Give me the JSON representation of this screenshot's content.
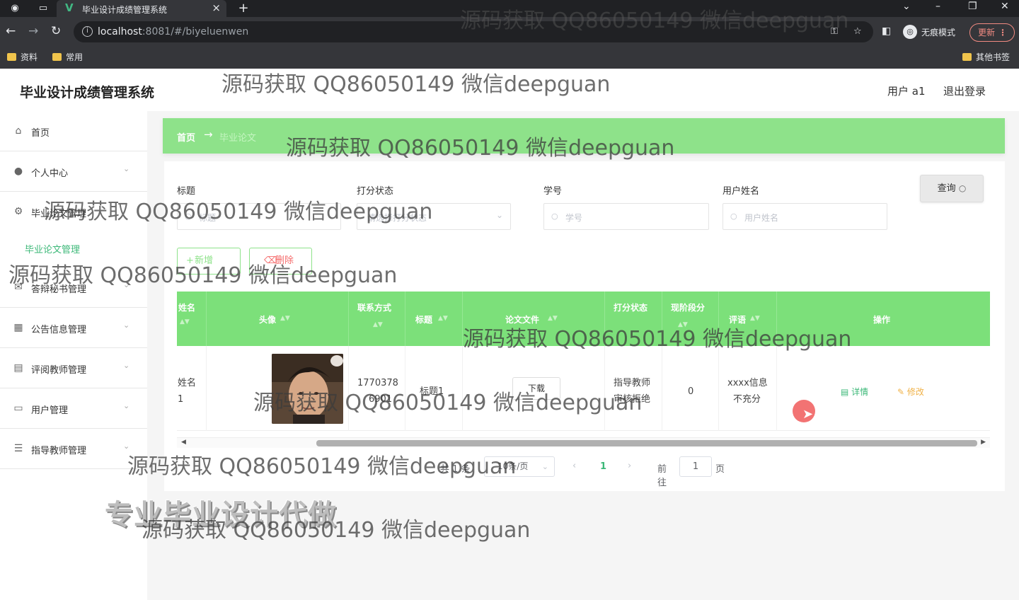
{
  "browser": {
    "tab_title": "毕业设计成绩管理系统",
    "url_host": "localhost",
    "url_rest": ":8081/#/biyeluenwen",
    "incognito_label": "无痕模式",
    "update_label": "更新",
    "bookmarks": [
      "资料",
      "常用"
    ],
    "other_bookmarks": "其他书签"
  },
  "header": {
    "title": "毕业设计成绩管理系统",
    "user": "用户 a1",
    "logout": "退出登录"
  },
  "sidebar": {
    "items": [
      {
        "label": "首页",
        "icon": "home-icon"
      },
      {
        "label": "个人中心",
        "icon": "user-icon"
      },
      {
        "label": "毕业论文管理",
        "icon": "settings-icon"
      },
      {
        "label": "答辩秘书管理",
        "icon": "mail-icon"
      },
      {
        "label": "公告信息管理",
        "icon": "grid-icon"
      },
      {
        "label": "评阅教师管理",
        "icon": "table-icon"
      },
      {
        "label": "用户管理",
        "icon": "chat-icon"
      },
      {
        "label": "指导教师管理",
        "icon": "list-icon"
      }
    ],
    "active_sub": "毕业论文管理"
  },
  "breadcrumb": {
    "home": "首页",
    "arrow": "→",
    "current": "毕业论文"
  },
  "search": {
    "title_label": "标题",
    "title_placeholder": "标题",
    "status_label": "打分状态",
    "status_placeholder": "请选择打分状态",
    "student_id_label": "学号",
    "student_id_placeholder": "学号",
    "username_label": "用户姓名",
    "username_placeholder": "用户姓名",
    "query_button": "查询"
  },
  "actions": {
    "add": "新增",
    "delete": "删除"
  },
  "table": {
    "headers": [
      "姓名",
      "头像",
      "联系方式",
      "标题",
      "论文文件",
      "打分状态",
      "现阶段分",
      "评语",
      "操作"
    ],
    "rows": [
      {
        "name_line1": "姓名",
        "name_line2": "1",
        "phone_line1": "1770378",
        "phone_line2": "6901",
        "title": "标题1",
        "file_button": "下载",
        "status_line1": "指导教师",
        "status_line2": "审核拒绝",
        "score": "0",
        "comment_line1": "xxxx信息",
        "comment_line2": "不充分",
        "detail": "详情",
        "edit": "修改"
      }
    ]
  },
  "pagination": {
    "total": "共 1 条",
    "page_size": "10条/页",
    "current_page": "1",
    "goto": "前往",
    "jump_value": "1",
    "unit": "页"
  },
  "overlay": {
    "promo": "专业毕业设计代做",
    "watermark": "源码获取 QQ86050149 微信deepguan"
  },
  "colors": {
    "accent": "#8ee28a",
    "header_green": "#7ce07a",
    "link_green": "#3cb878",
    "danger": "#f56c6c",
    "warning": "#f0b248"
  }
}
